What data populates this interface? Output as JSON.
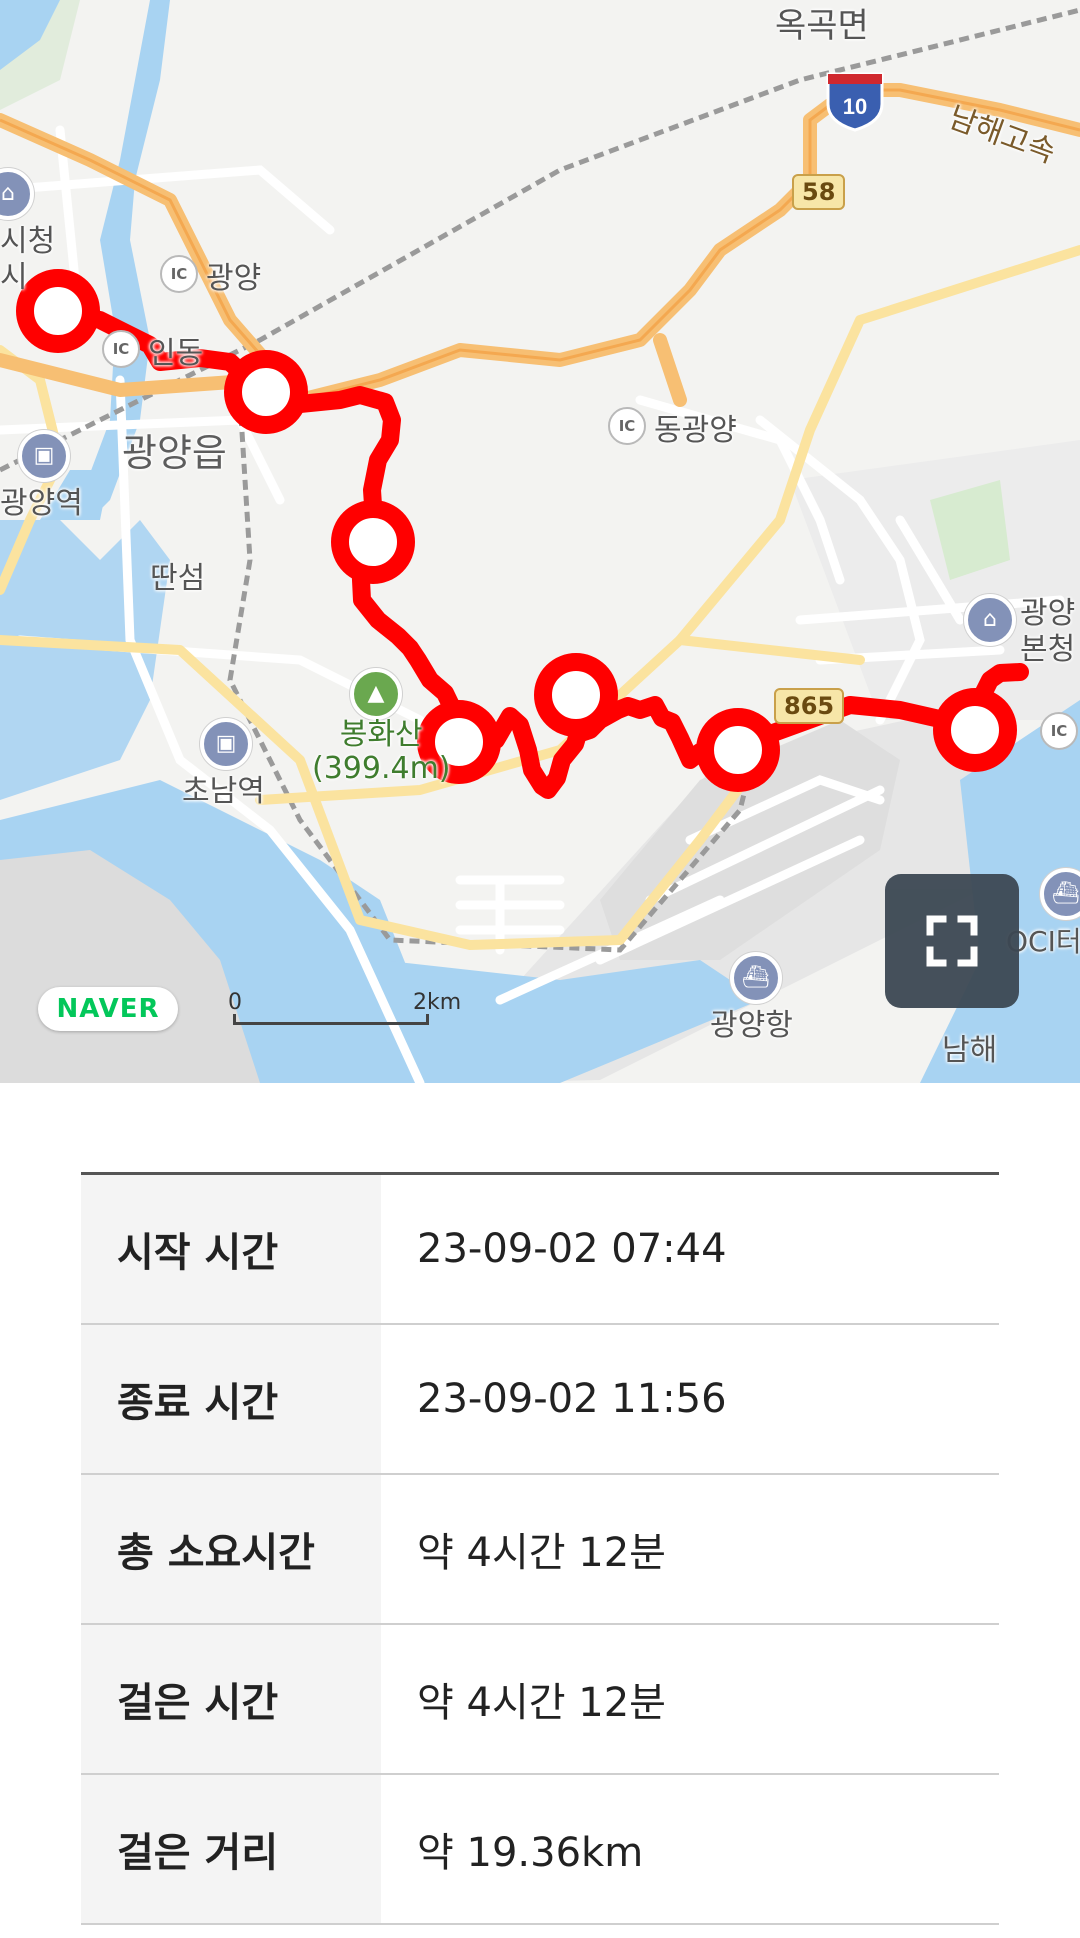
{
  "map": {
    "places": {
      "okgok": "옥곡면",
      "namhae_expressway": "남해고속",
      "city_hall": "시청",
      "city_hall_partial": "시",
      "ic_gwangyang": "광양",
      "ic_indong": "인동",
      "gwangyang_eup": "광양읍",
      "ic_donggwangyang": "동광양",
      "gwangyang_station": "광양역",
      "ttanseom": "딴섬",
      "bonghwasan": "봉화산",
      "bonghwasan_elev": "(399.4m)",
      "chonam_station": "초남역",
      "gwangyang_main_office_1": "광양",
      "gwangyang_main_office_2": "본청",
      "gwangyang_port": "광양항",
      "namhae": "남해",
      "oci": "OCI터"
    },
    "ic_label": "IC",
    "route_numbers": {
      "expressway": "10",
      "road_58": "58",
      "road_865": "865"
    },
    "logo": "NAVER",
    "scale": {
      "start": "0",
      "end": "2km"
    },
    "icons": {
      "fullscreen": "fullscreen-icon",
      "waypoint": "waypoint-marker-icon",
      "mountain": "mountain-icon",
      "train": "train-station-icon",
      "ship": "port-icon",
      "government": "government-building-icon"
    },
    "colors": {
      "route": "#ff0000",
      "water": "#a8d3f2",
      "road_major": "#f9c87a",
      "road_minor": "#ffffff"
    }
  },
  "table": {
    "rows": [
      {
        "label": "시작 시간",
        "value": "23-09-02 07:44"
      },
      {
        "label": "종료 시간",
        "value": "23-09-02 11:56"
      },
      {
        "label": "총 소요시간",
        "value": "약 4시간 12분"
      },
      {
        "label": "걸은 시간",
        "value": "약 4시간 12분"
      },
      {
        "label": "걸은 거리",
        "value": "약 19.36km"
      }
    ]
  }
}
